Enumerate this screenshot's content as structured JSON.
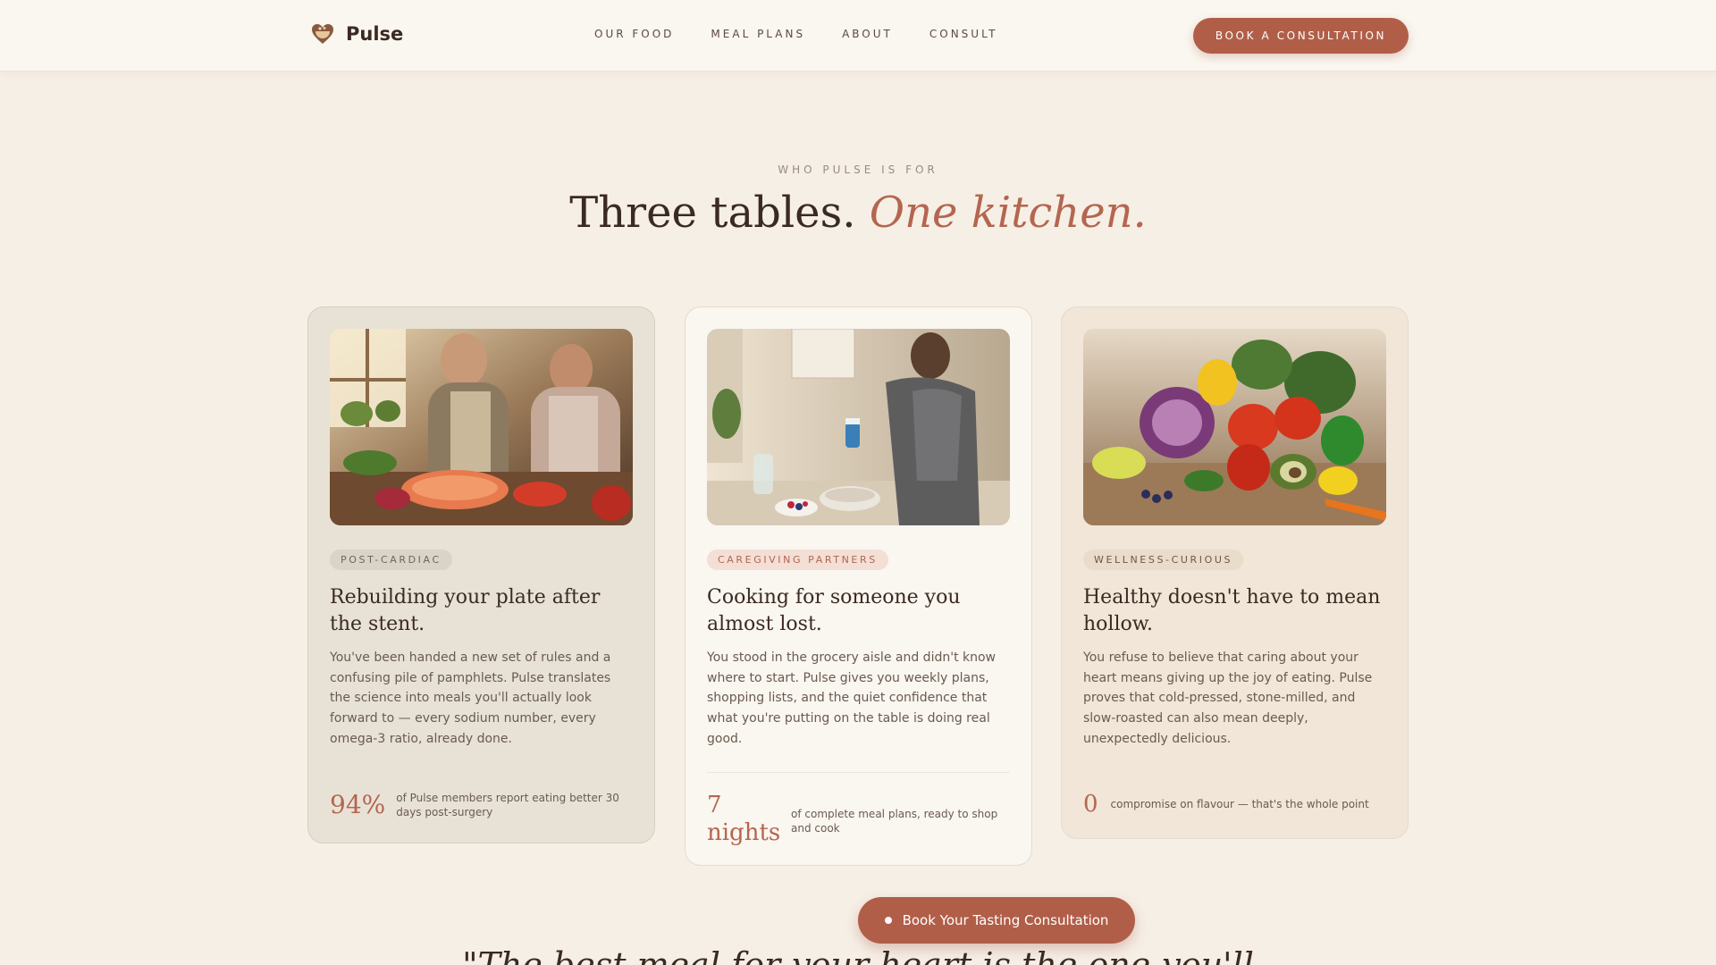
{
  "nav": {
    "brand": "Pulse",
    "links": [
      "OUR FOOD",
      "MEAL PLANS",
      "ABOUT",
      "CONSULT"
    ],
    "cta": "BOOK A CONSULTATION"
  },
  "hero": {
    "eyebrow": "WHO PULSE IS FOR",
    "title_main": "Three tables.",
    "title_accent": "One kitchen."
  },
  "cards": [
    {
      "image": "couple preparing salmon and vegetables",
      "tag": "POST-CARDIAC",
      "title": "Rebuilding your plate after the stent.",
      "body": "You've been handed a new set of rules and a confusing pile of pamphlets. Pulse translates the science into meals you'll actually look forward to — every sodium number, every omega-3 ratio, already done.",
      "stat_value": "94%",
      "stat_label": "of Pulse members report eating better 30 days post-surgery"
    },
    {
      "image": "woman preparing a breakfast bowl in kitchen",
      "tag": "CAREGIVING PARTNERS",
      "title": "Cooking for someone you almost lost.",
      "body": "You stood in the grocery aisle and didn't know where to start. Pulse gives you weekly plans, shopping lists, and the quiet confidence that what you're putting on the table is doing real good.",
      "stat_value": "7 nights",
      "stat_label": "of complete meal plans, ready to shop and cook"
    },
    {
      "image": "pile of fresh colorful vegetables on wood table",
      "tag": "WELLNESS-CURIOUS",
      "title": "Healthy doesn't have to mean hollow.",
      "body": "You refuse to believe that caring about your heart means giving up the joy of eating. Pulse proves that cold-pressed, stone-milled, and slow-roasted can also mean deeply, unexpectedly delicious.",
      "stat_value": "0",
      "stat_label": "compromise on flavour — that's the whole point"
    }
  ],
  "cta": "Book Your Tasting Consultation",
  "quote": "\"The best meal for your heart is the one you'll"
}
